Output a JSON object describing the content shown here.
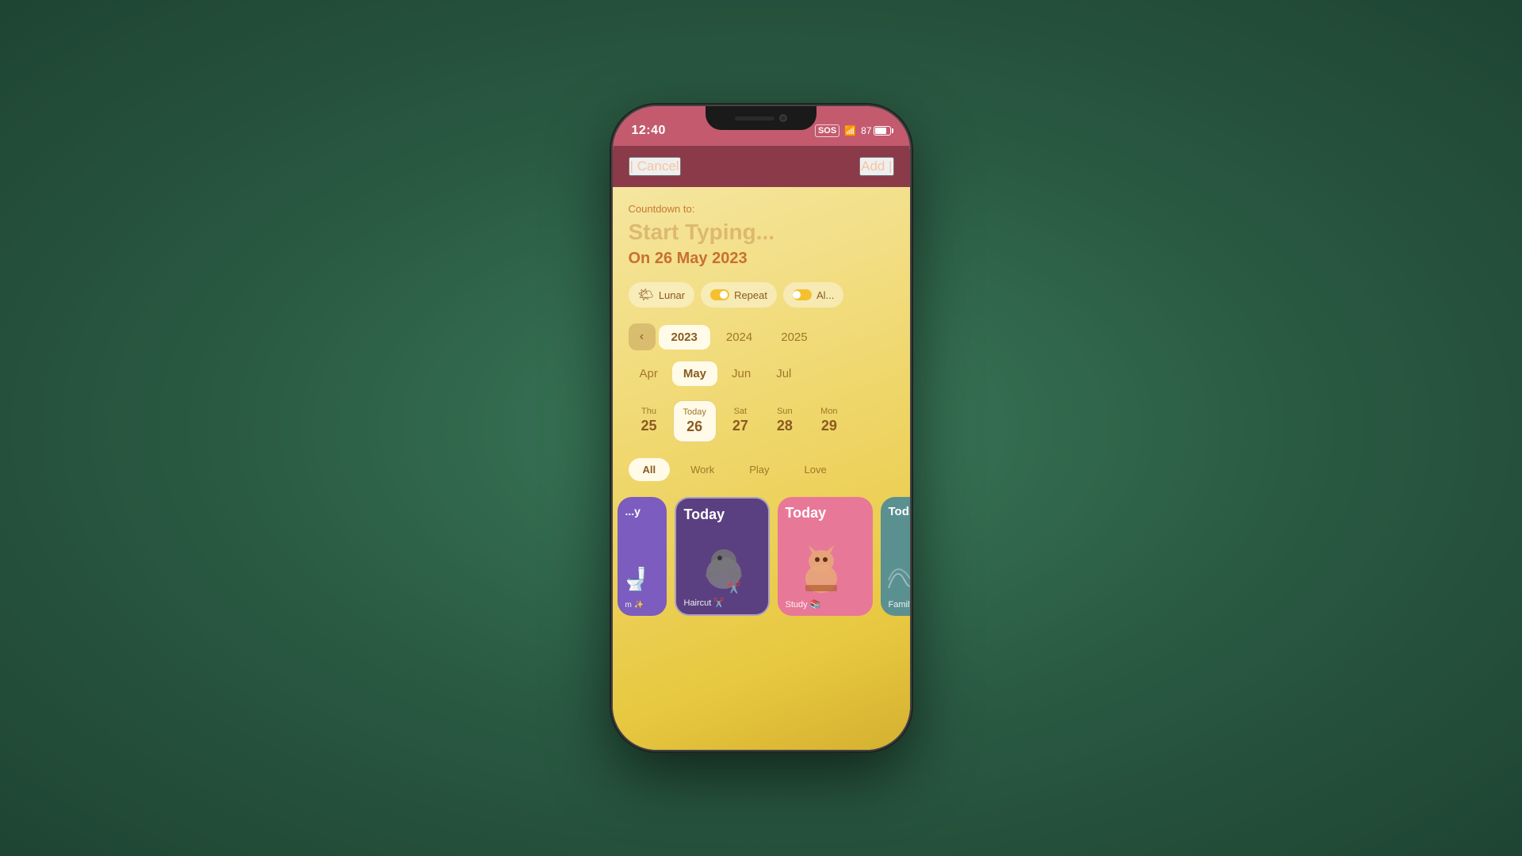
{
  "status_bar": {
    "time": "12:40",
    "sos": "SOS",
    "battery": "87"
  },
  "header": {
    "cancel_label": "| Cancel",
    "add_label": "Add |"
  },
  "countdown": {
    "label": "Countdown to:",
    "placeholder": "Start Typing...",
    "date": "On 26 May 2023"
  },
  "toggles": {
    "lunar": "Lunar",
    "repeat": "Repeat",
    "alarm": "Al..."
  },
  "years": {
    "prev_arrow": "‹",
    "items": [
      "2023",
      "2024",
      "2025"
    ]
  },
  "months": {
    "items": [
      "Apr",
      "May",
      "Jun",
      "Jul"
    ]
  },
  "days": {
    "items": [
      {
        "name": "Thu",
        "num": "25"
      },
      {
        "name": "Today",
        "num": "26"
      },
      {
        "name": "Sat",
        "num": "27"
      },
      {
        "name": "Sun",
        "num": "28"
      },
      {
        "name": "Mon",
        "num": "29"
      }
    ]
  },
  "categories": {
    "items": [
      "All",
      "Work",
      "Play",
      "Love"
    ]
  },
  "widgets": [
    {
      "today": "Today",
      "name": "...m ✨",
      "color": "purple"
    },
    {
      "today": "Today",
      "name": "Haircut ✂️",
      "color": "dark-purple"
    },
    {
      "today": "Today",
      "name": "Study 📚",
      "color": "pink"
    },
    {
      "today": "Today",
      "name": "Family 🏠",
      "color": "teal"
    }
  ]
}
